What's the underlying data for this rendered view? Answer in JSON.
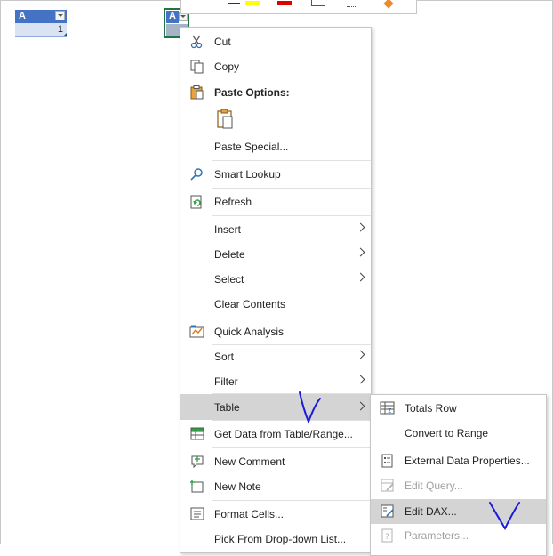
{
  "table1": {
    "header": "A",
    "value": "1"
  },
  "table2": {
    "header": "A"
  },
  "menu": {
    "cut": "Cut",
    "copy": "Copy",
    "paste_options": "Paste Options:",
    "paste_special": "Paste Special...",
    "smart_lookup": "Smart Lookup",
    "refresh": "Refresh",
    "insert": "Insert",
    "delete": "Delete",
    "select": "Select",
    "clear_contents": "Clear Contents",
    "quick_analysis": "Quick Analysis",
    "sort": "Sort",
    "filter": "Filter",
    "table": "Table",
    "get_data": "Get Data from Table/Range...",
    "new_comment": "New Comment",
    "new_note": "New Note",
    "format_cells": "Format Cells...",
    "pick_list": "Pick From Drop-down List..."
  },
  "submenu": {
    "totals_row": "Totals Row",
    "convert_to_range": "Convert to Range",
    "external_data_properties": "External Data Properties...",
    "edit_query": "Edit Query...",
    "edit_dax": "Edit DAX...",
    "parameters": "Parameters..."
  },
  "colors": {
    "table_header": "#4472c4",
    "selection_border": "#217346",
    "highlight": "#d4d4d4",
    "annotation": "#1a1ad8"
  }
}
